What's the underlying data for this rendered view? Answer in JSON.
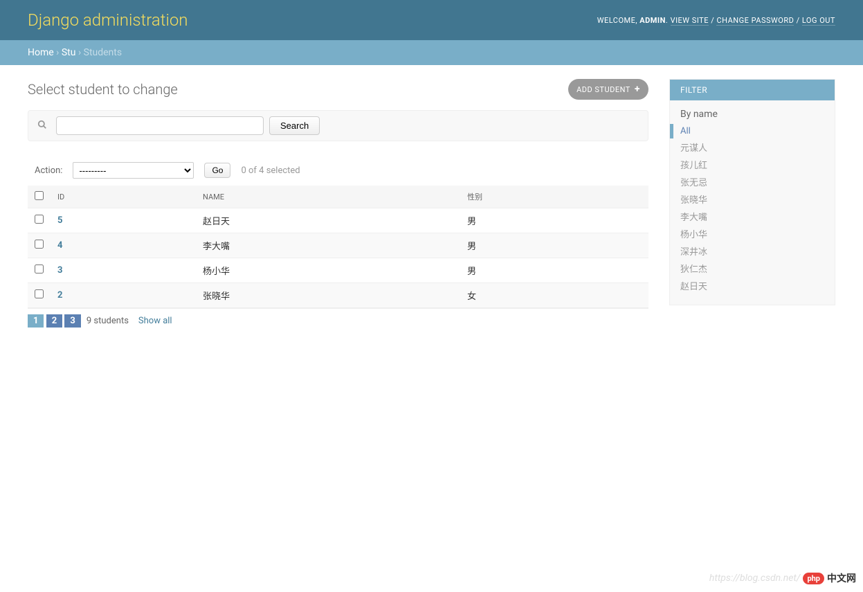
{
  "header": {
    "title": "Django administration",
    "welcome_prefix": "Welcome, ",
    "user": "ADMIN",
    "view_site": "View site",
    "change_password": "Change password",
    "log_out": "Log out",
    "sep": " / "
  },
  "breadcrumbs": {
    "home": "Home",
    "app": "Stu",
    "model": "Students",
    "sep": " › "
  },
  "page": {
    "title": "Select student to change",
    "add_label": "ADD STUDENT"
  },
  "search": {
    "placeholder": "",
    "button": "Search"
  },
  "actions": {
    "label": "Action:",
    "default_option": "---------",
    "go": "Go",
    "counter": "0 of 4 selected"
  },
  "table": {
    "headers": {
      "id": "ID",
      "name": "Name",
      "gender": "性别"
    },
    "rows": [
      {
        "id": "5",
        "name": "赵日天",
        "gender": "男"
      },
      {
        "id": "4",
        "name": "李大嘴",
        "gender": "男"
      },
      {
        "id": "3",
        "name": "杨小华",
        "gender": "男"
      },
      {
        "id": "2",
        "name": "张晓华",
        "gender": "女"
      }
    ]
  },
  "paginator": {
    "pages": [
      "1",
      "2",
      "3"
    ],
    "current": "1",
    "count_label": "9 students",
    "show_all": "Show all"
  },
  "filter": {
    "title": "Filter",
    "by_label": "By name",
    "selected": "All",
    "options": [
      "All",
      "元谋人",
      "孩儿红",
      "张无忌",
      "张晓华",
      "李大嘴",
      "杨小华",
      "深井冰",
      "狄仁杰",
      "赵日天"
    ]
  },
  "watermark": {
    "url": "https://blog.csdn.net/",
    "logo": "php",
    "cn": "中文网"
  }
}
